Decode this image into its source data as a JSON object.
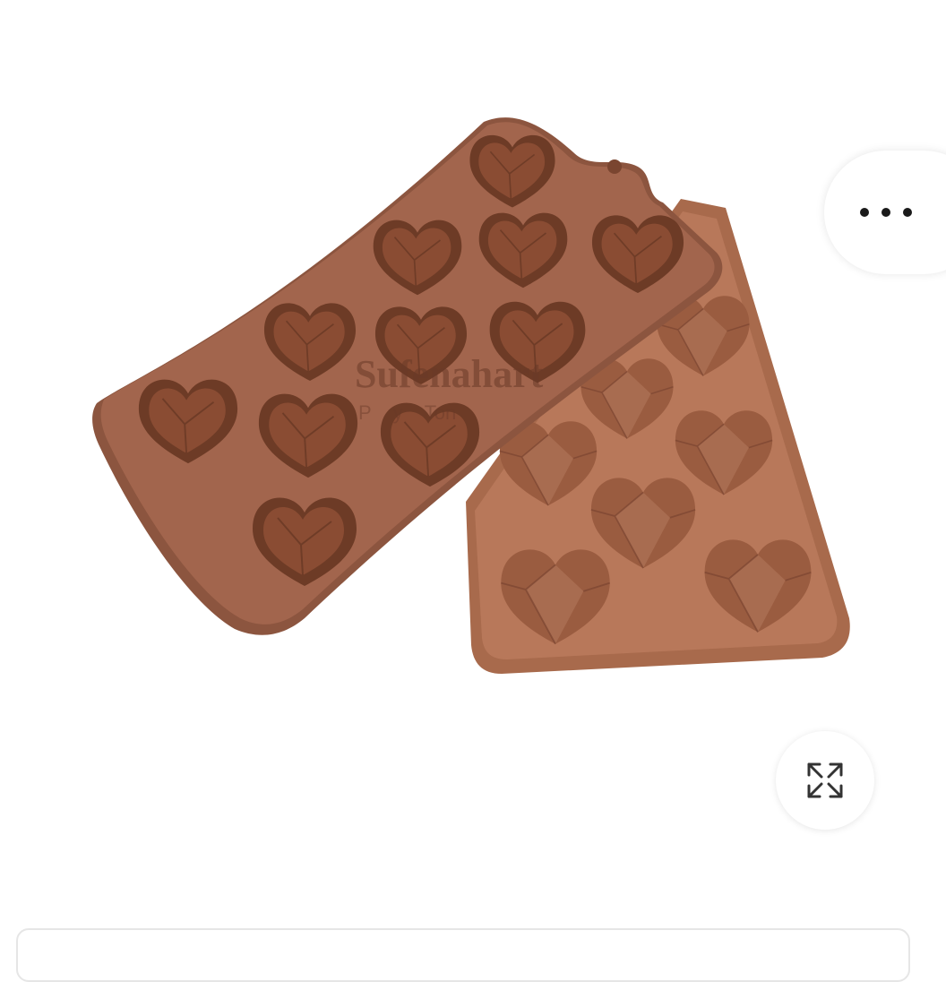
{
  "product_image": {
    "watermark_line1": "Sufenahart",
    "watermark_line2": "P    y    Ton"
  },
  "colors": {
    "mold_front": "#a2654d",
    "mold_front_edge": "#8c553f",
    "mold_back": "#a86a4c",
    "heart_shell": "#6d3b26",
    "heart_face": "#b07153",
    "background": "#ffffff"
  },
  "icons": {
    "more": "more-horizontal-icon",
    "expand": "expand-arrows-icon"
  }
}
